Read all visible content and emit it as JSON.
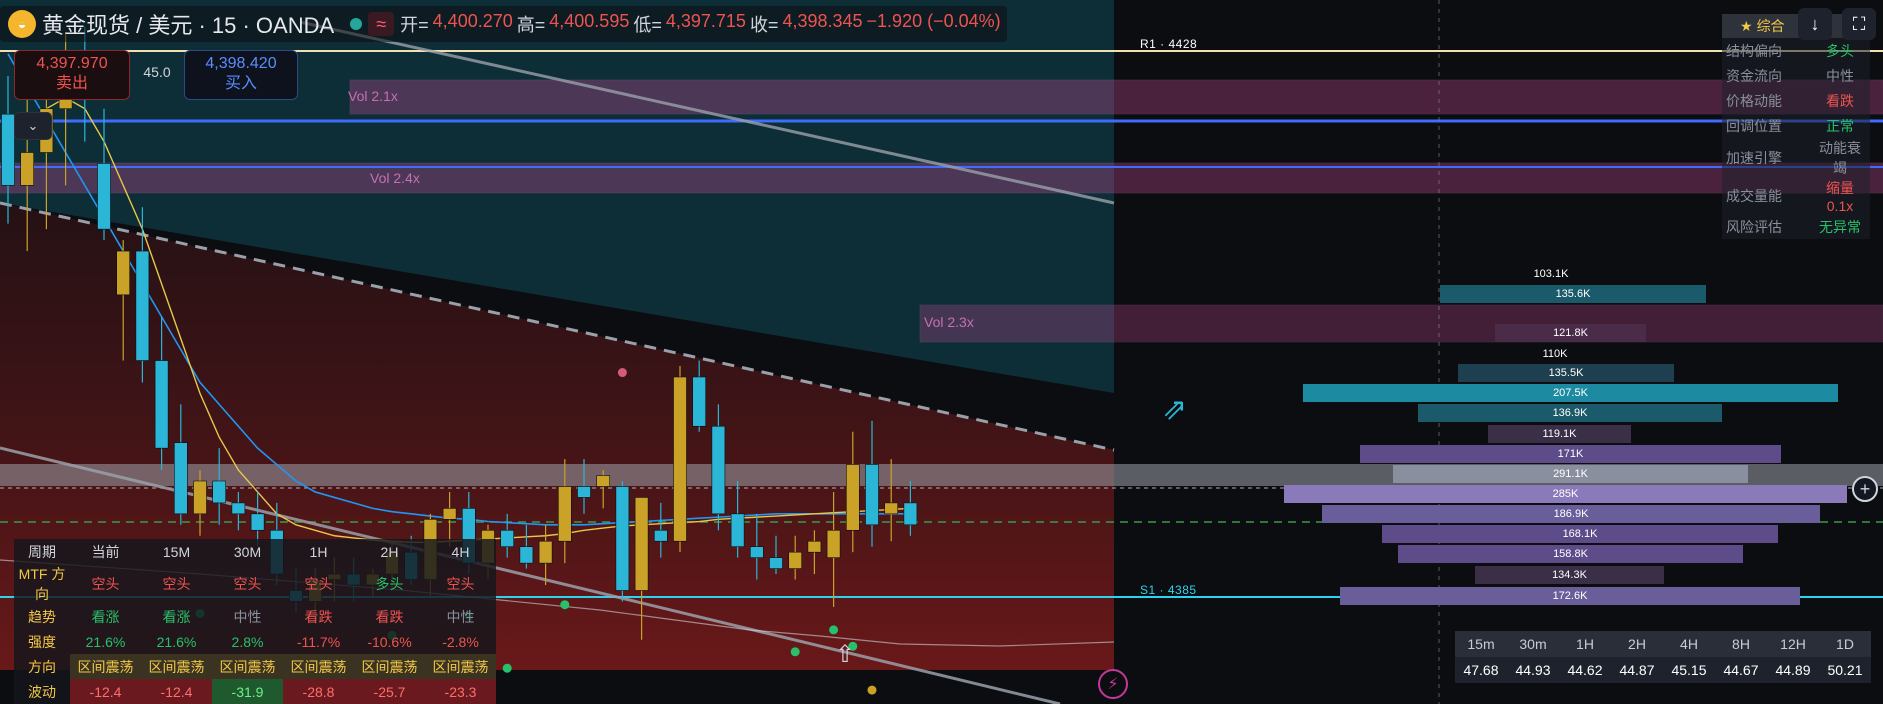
{
  "header": {
    "symbol": "黄金现货 / 美元 · 15 · OANDA",
    "approx_icon": "≈",
    "open_label": "开=",
    "open": "4,400.270",
    "high_label": "高=",
    "high": "4,400.595",
    "low_label": "低=",
    "low": "4,397.715",
    "close_label": "收=",
    "close": "4,398.345",
    "change": "−1.920 (−0.04%)"
  },
  "trade": {
    "sell_price": "4,397.970",
    "sell_label": "卖出",
    "spread": "45.0",
    "buy_price": "4,398.420",
    "buy_label": "买入"
  },
  "levels": {
    "r1": "R1 · 4428",
    "s1": "S1 · 4385"
  },
  "vol_labels": [
    "Vol 2.1x",
    "Vol 2.4x",
    "Vol 2.3x"
  ],
  "panel": {
    "title": "综合",
    "rows": [
      {
        "k": "结构偏向",
        "v": "多头",
        "c": "#26c26a"
      },
      {
        "k": "资金流向",
        "v": "中性",
        "c": "#8a8f9c"
      },
      {
        "k": "价格动能",
        "v": "看跌",
        "c": "#ef5350"
      },
      {
        "k": "回调位置",
        "v": "正常",
        "c": "#26c26a"
      },
      {
        "k": "加速引擎",
        "v": "动能衰竭",
        "c": "#8a8f9c"
      },
      {
        "k": "成交量能",
        "v": "缩量 0.1x",
        "c": "#ef5350"
      },
      {
        "k": "风险评估",
        "v": "无异常",
        "c": "#26c26a"
      }
    ]
  },
  "volume_profile": [
    "103.1K",
    "135.6K",
    "121.8K",
    "110K",
    "135.5K",
    "207.5K",
    "136.9K",
    "119.1K",
    "171K",
    "291.1K",
    "285K",
    "186.9K",
    "168.1K",
    "158.8K",
    "134.3K",
    "172.6K"
  ],
  "mtf": {
    "header": [
      "周期",
      "当前",
      "15M",
      "30M",
      "1H",
      "2H",
      "4H"
    ],
    "rows": [
      {
        "label": "MTF 方向",
        "cells": [
          "空头",
          "空头",
          "空头",
          "空头",
          "多头",
          "空头"
        ]
      },
      {
        "label": "趋势",
        "cells": [
          "看涨",
          "看涨",
          "中性",
          "看跌",
          "看跌",
          "中性"
        ]
      },
      {
        "label": "强度",
        "cells": [
          "21.6%",
          "21.6%",
          "2.8%",
          "-11.7%",
          "-10.6%",
          "-2.8%"
        ]
      },
      {
        "label": "方向",
        "cells": [
          "区间震荡",
          "区间震荡",
          "区间震荡",
          "区间震荡",
          "区间震荡",
          "区间震荡"
        ]
      },
      {
        "label": "波动",
        "cells": [
          "-12.4",
          "-12.4",
          "-31.9",
          "-28.8",
          "-25.7",
          "-23.3"
        ]
      }
    ]
  },
  "timeframes": {
    "labels": [
      "15m",
      "30m",
      "1H",
      "2H",
      "4H",
      "8H",
      "12H",
      "1D"
    ],
    "values": [
      "47.68",
      "44.93",
      "44.62",
      "44.87",
      "45.15",
      "44.67",
      "44.89",
      "50.21"
    ]
  },
  "colors": {
    "up": "#c9a227",
    "down": "#2bb6d8",
    "bear": "#ef5350",
    "bull": "#26c26a"
  },
  "icons": {
    "scroll": "↓",
    "fullscreen": "⛶",
    "plus": "+",
    "bolt": "⚡",
    "uparrow": "⇧",
    "diag": "⇗",
    "collapse": "⌄"
  },
  "chart_data": {
    "type": "candlestick",
    "candles": [
      {
        "o": 4430.5,
        "h": 4434,
        "l": 4420.5,
        "c": 4424
      },
      {
        "o": 4424,
        "h": 4432,
        "l": 4418,
        "c": 4427
      },
      {
        "o": 4427,
        "h": 4436,
        "l": 4420,
        "c": 4431
      },
      {
        "o": 4431,
        "h": 4438,
        "l": 4424,
        "c": 4434
      },
      {
        "o": 4434,
        "h": 4438.5,
        "l": 4428,
        "c": 4432
      },
      {
        "o": 4426,
        "h": 4431,
        "l": 4419,
        "c": 4420
      },
      {
        "o": 4414,
        "h": 4419,
        "l": 4408,
        "c": 4418
      },
      {
        "o": 4418,
        "h": 4422,
        "l": 4406,
        "c": 4408
      },
      {
        "o": 4408,
        "h": 4412,
        "l": 4398,
        "c": 4400
      },
      {
        "o": 4400.5,
        "h": 4404,
        "l": 4393,
        "c": 4394
      },
      {
        "o": 4394,
        "h": 4398,
        "l": 4392,
        "c": 4397
      },
      {
        "o": 4397,
        "h": 4400,
        "l": 4393,
        "c": 4395
      },
      {
        "o": 4395,
        "h": 4396,
        "l": 4392.5,
        "c": 4394
      },
      {
        "o": 4394,
        "h": 4396,
        "l": 4391,
        "c": 4392.5
      },
      {
        "o": 4392.5,
        "h": 4395,
        "l": 4387.5,
        "c": 4388.5
      },
      {
        "o": 4387,
        "h": 4389,
        "l": 4385,
        "c": 4386
      },
      {
        "o": 4386,
        "h": 4389,
        "l": 4384,
        "c": 4388
      },
      {
        "o": 4388,
        "h": 4390,
        "l": 4386,
        "c": 4388.5
      },
      {
        "o": 4388.5,
        "h": 4390,
        "l": 4386,
        "c": 4387.5
      },
      {
        "o": 4387.5,
        "h": 4389,
        "l": 4386.5,
        "c": 4388.5
      },
      {
        "o": 4388.5,
        "h": 4391.5,
        "l": 4387,
        "c": 4390.5
      },
      {
        "o": 4390.5,
        "h": 4392,
        "l": 4387.5,
        "c": 4388
      },
      {
        "o": 4388,
        "h": 4394,
        "l": 4386.5,
        "c": 4393.5
      },
      {
        "o": 4393.5,
        "h": 4396,
        "l": 4391,
        "c": 4394.5
      },
      {
        "o": 4394.5,
        "h": 4396,
        "l": 4388.5,
        "c": 4389.5
      },
      {
        "o": 4389.5,
        "h": 4393,
        "l": 4388,
        "c": 4392.5
      },
      {
        "o": 4392.5,
        "h": 4394,
        "l": 4390,
        "c": 4391
      },
      {
        "o": 4391,
        "h": 4393,
        "l": 4389,
        "c": 4389.5
      },
      {
        "o": 4389.5,
        "h": 4393,
        "l": 4387.5,
        "c": 4391.5
      },
      {
        "o": 4391.5,
        "h": 4399,
        "l": 4389.5,
        "c": 4396.5
      },
      {
        "o": 4396.5,
        "h": 4399,
        "l": 4394,
        "c": 4395.5
      },
      {
        "o": 4396.5,
        "h": 4398,
        "l": 4394.5,
        "c": 4397.5
      },
      {
        "o": 4396.5,
        "h": 4397,
        "l": 4386,
        "c": 4387
      },
      {
        "o": 4387,
        "h": 4395.5,
        "l": 4382.5,
        "c": 4395.5
      },
      {
        "o": 4392.5,
        "h": 4395,
        "l": 4390,
        "c": 4391.5
      },
      {
        "o": 4391.5,
        "h": 4407.5,
        "l": 4390.5,
        "c": 4406.5
      },
      {
        "o": 4406.5,
        "h": 4408,
        "l": 4401.5,
        "c": 4402
      },
      {
        "o": 4402,
        "h": 4404,
        "l": 4392.5,
        "c": 4394
      },
      {
        "o": 4394,
        "h": 4397,
        "l": 4390,
        "c": 4391
      },
      {
        "o": 4391,
        "h": 4394,
        "l": 4388,
        "c": 4390
      },
      {
        "o": 4390,
        "h": 4392,
        "l": 4388.5,
        "c": 4389
      },
      {
        "o": 4389,
        "h": 4392,
        "l": 4388,
        "c": 4390.5
      },
      {
        "o": 4390.5,
        "h": 4392.5,
        "l": 4388.5,
        "c": 4391.5
      },
      {
        "o": 4390,
        "h": 4396,
        "l": 4385.5,
        "c": 4392.5
      },
      {
        "o": 4392.5,
        "h": 4401.5,
        "l": 4390.5,
        "c": 4398.5
      },
      {
        "o": 4398.5,
        "h": 4402.5,
        "l": 4391,
        "c": 4393
      },
      {
        "o": 4394,
        "h": 4399,
        "l": 4391.5,
        "c": 4395
      },
      {
        "o": 4395,
        "h": 4397,
        "l": 4392,
        "c": 4393
      }
    ],
    "ema": [
      4436,
      4433,
      4430,
      4427,
      4424,
      4421,
      4418,
      4415,
      4412,
      4409,
      4406,
      4404,
      4402,
      4400,
      4398.5,
      4397,
      4396,
      4395.5,
      4395,
      4394.5,
      4394.2,
      4394,
      4393.8,
      4393.6,
      4393.5,
      4393.3,
      4393.2,
      4393.1,
      4393.0,
      4393.0,
      4393.0,
      4393.1,
      4393.2,
      4393.3,
      4393.4,
      4393.5,
      4393.6,
      4393.7,
      4393.8,
      4393.9,
      4394,
      4394,
      4394,
      4394,
      4394,
      4394,
      4394,
      4394
    ],
    "ma_slow": [
      4428,
      4430,
      4431,
      4432,
      4431,
      4428,
      4424,
      4420,
      4415,
      4410,
      4405,
      4401,
      4398,
      4396,
      4394,
      4393,
      4392.5,
      4392,
      4391.8,
      4391.6,
      4391.5,
      4391.4,
      4391.4,
      4391.5,
      4391.6,
      4391.7,
      4391.8,
      4391.9,
      4392,
      4392.2,
      4392.5,
      4392.7,
      4392.9,
      4393.0,
      4393.1,
      4393.2,
      4393.3,
      4393.5,
      4393.6,
      4393.7,
      4393.8,
      4393.9,
      4394,
      4394.1,
      4394.2,
      4394.3,
      4394.4,
      4394.5
    ],
    "levels": {
      "r1": 4428,
      "s1": 4385
    },
    "yrange": [
      4377,
      4440
    ]
  }
}
